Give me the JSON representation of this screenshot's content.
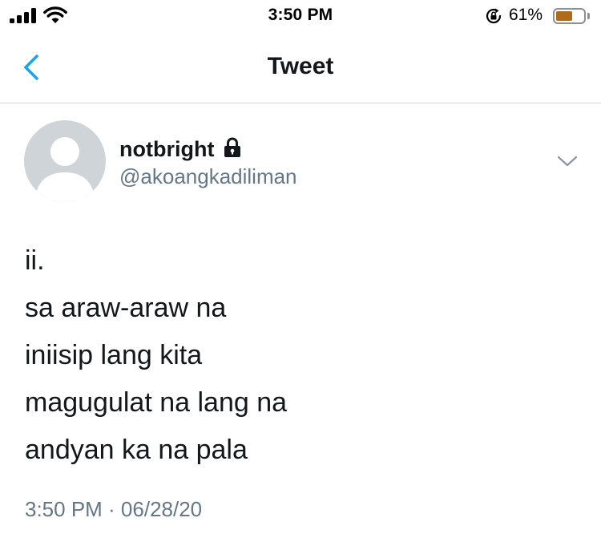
{
  "status_bar": {
    "time": "3:50 PM",
    "battery_percent": "61%",
    "battery_level": 0.61,
    "battery_color": "#b06b1a",
    "signal_icon": "cellular-signal-icon",
    "wifi_icon": "wifi-icon",
    "rotation_icon": "rotation-lock-icon"
  },
  "nav": {
    "title": "Tweet",
    "back_icon": "chevron-left-icon",
    "accent_color": "#1da1f2"
  },
  "tweet": {
    "display_name": "notbright",
    "protected_icon": "lock-icon",
    "handle": "@akoangkadiliman",
    "menu_icon": "chevron-down-icon",
    "lines": [
      "ii.",
      "sa araw-araw na",
      "iniisip lang kita",
      "magugulat na lang na",
      "andyan ka na pala"
    ],
    "timestamp": "3:50 PM · 06/28/20"
  }
}
